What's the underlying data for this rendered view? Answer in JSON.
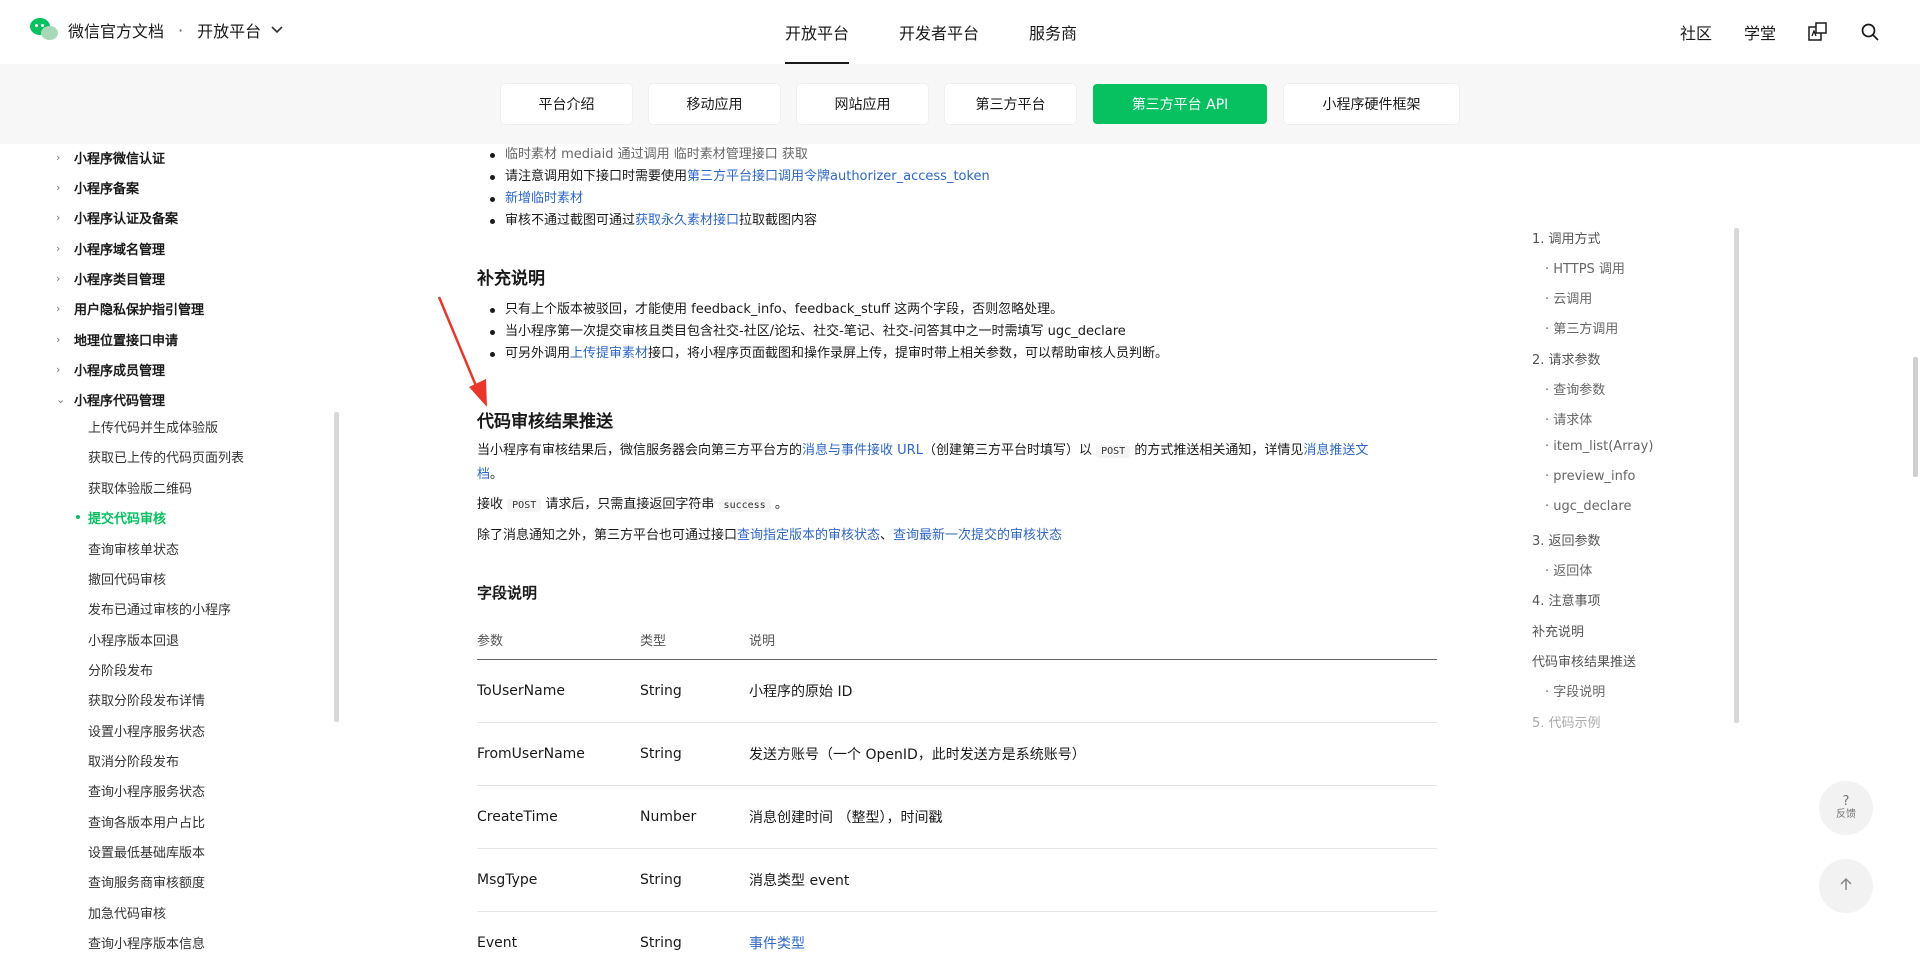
{
  "header": {
    "brand": "微信官方文档",
    "separator": "·",
    "platform": "开放平台",
    "nav": [
      "开放平台",
      "开发者平台",
      "服务商"
    ],
    "right": {
      "community": "社区",
      "academy": "学堂"
    }
  },
  "subnav": {
    "tabs": [
      "平台介绍",
      "移动应用",
      "网站应用",
      "第三方平台",
      "第三方平台 API",
      "小程序硬件框架"
    ],
    "active_index": 4,
    "accent": "#07c160"
  },
  "sidebar": {
    "groups": [
      "小程序微信认证",
      "小程序备案",
      "小程序认证及备案",
      "小程序域名管理",
      "小程序类目管理",
      "用户隐私保护指引管理",
      "地理位置接口申请",
      "小程序成员管理",
      "小程序代码管理"
    ],
    "expanded_group": "小程序代码管理",
    "items": [
      "上传代码并生成体验版",
      "获取已上传的代码页面列表",
      "获取体验版二维码",
      "提交代码审核",
      "查询审核单状态",
      "撤回代码审核",
      "发布已通过审核的小程序",
      "小程序版本回退",
      "分阶段发布",
      "获取分阶段发布详情",
      "设置小程序服务状态",
      "取消分阶段发布",
      "查询小程序服务状态",
      "查询各版本用户占比",
      "设置最低基础库版本",
      "查询服务商审核额度",
      "加急代码审核",
      "查询小程序版本信息"
    ],
    "active_item": "提交代码审核"
  },
  "content": {
    "top_list": {
      "line1": "临时素材 mediaid 通过调用 临时素材管理接口 获取",
      "line2_pre": "请注意调用如下接口时需要使用",
      "line2_link": "第三方平台接口调用令牌authorizer_access_token",
      "line3_link": "新增临时素材",
      "line4_pre": "审核不通过截图可通过",
      "line4_link": "获取永久素材接口",
      "line4_post": "拉取截图内容"
    },
    "supplement": {
      "title": "补充说明",
      "b1": "只有上个版本被驳回，才能使用 feedback_info、feedback_stuff 这两个字段，否则忽略处理。",
      "b2": "当小程序第一次提交审核且类目包含社交-社区/论坛、社交-笔记、社交-问答其中之一时需填写 ugc_declare",
      "b3_pre": "可另外调用",
      "b3_link": "上传提审素材",
      "b3_post": "接口，将小程序页面截图和操作录屏上传，提审时带上相关参数，可以帮助审核人员判断。"
    },
    "push": {
      "title": "代码审核结果推送",
      "p1_pre": "当小程序有审核结果后，微信服务器会向第三方平台方的",
      "p1_link": "消息与事件接收 URL",
      "p1_mid": "（创建第三方平台时填写）以",
      "p1_code": "POST",
      "p1_post": "的方式推送相关通知，详情见",
      "p1_link2a": "消息推送文",
      "p1_link2b": "档",
      "p1_end": "。",
      "p2_pre": "接收",
      "p2_code1": "POST",
      "p2_mid": "请求后，只需直接返回字符串",
      "p2_code2": "success",
      "p2_end": "。",
      "p3_pre": "除了消息通知之外，第三方平台也可通过接口",
      "p3_link1": "查询指定版本的审核状态",
      "p3_sep": "、",
      "p3_link2": "查询最新一次提交的审核状态"
    },
    "fields": {
      "title": "字段说明",
      "headers": [
        "参数",
        "类型",
        "说明"
      ],
      "rows": [
        [
          "ToUserName",
          "String",
          "小程序的原始 ID"
        ],
        [
          "FromUserName",
          "String",
          "发送方账号（一个 OpenID，此时发送方是系统账号）"
        ],
        [
          "CreateTime",
          "Number",
          "消息创建时间 （整型），时间戳"
        ],
        [
          "MsgType",
          "String",
          "消息类型 event"
        ],
        [
          "Event",
          "String",
          "事件类型"
        ]
      ]
    }
  },
  "toc": {
    "items": [
      {
        "label": "1. 调用方式",
        "level": 0
      },
      {
        "label": "HTTPS 调用",
        "level": 1
      },
      {
        "label": "云调用",
        "level": 1
      },
      {
        "label": "第三方调用",
        "level": 1
      },
      {
        "label": "2. 请求参数",
        "level": 0
      },
      {
        "label": "查询参数",
        "level": 1
      },
      {
        "label": "请求体",
        "level": 1
      },
      {
        "label": "item_list(Array)",
        "level": 1
      },
      {
        "label": "preview_info",
        "level": 1
      },
      {
        "label": "ugc_declare",
        "level": 1
      },
      {
        "label": "3. 返回参数",
        "level": 0
      },
      {
        "label": "返回体",
        "level": 1
      },
      {
        "label": "4. 注意事项",
        "level": 0
      },
      {
        "label": "补充说明",
        "level": 0
      },
      {
        "label": "代码审核结果推送",
        "level": 0
      },
      {
        "label": "字段说明",
        "level": 1
      },
      {
        "label": "5. 代码示例",
        "level": 0
      }
    ]
  },
  "floating": {
    "help_q": "?",
    "help_label": "反馈",
    "top_icon": "arrow-up-icon"
  }
}
